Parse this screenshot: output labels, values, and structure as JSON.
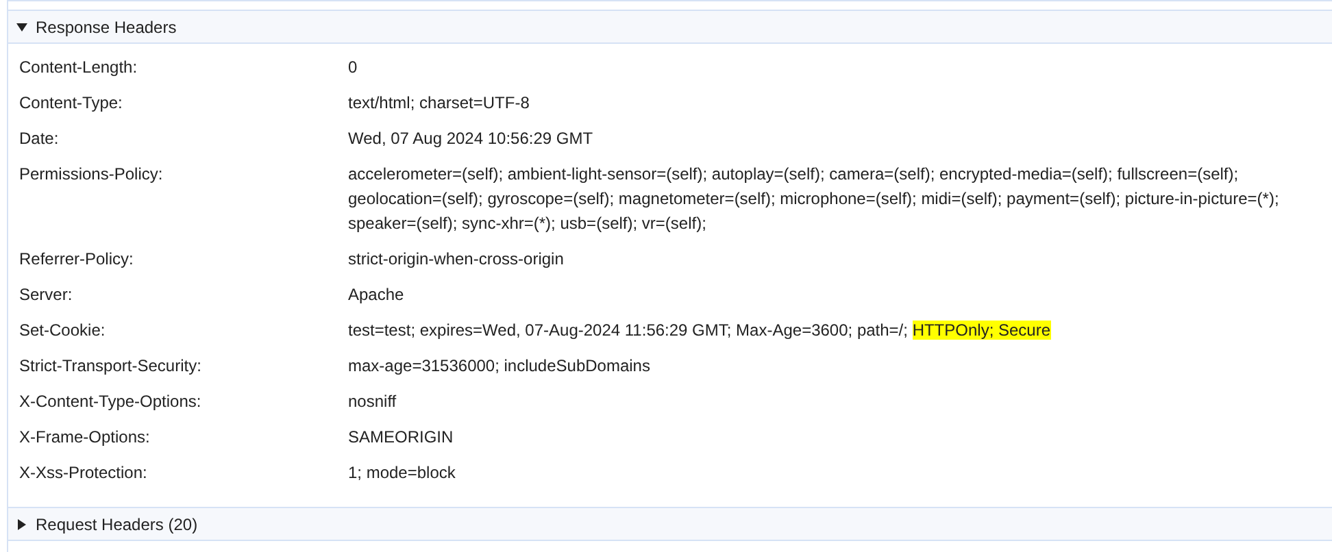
{
  "sections": [
    {
      "title": "Response Headers",
      "expanded": true,
      "headers": [
        {
          "name": "Content-Length:",
          "value": [
            {
              "text": "0",
              "highlighted": false
            }
          ]
        },
        {
          "name": "Content-Type:",
          "value": [
            {
              "text": "text/html; charset=UTF-8",
              "highlighted": false
            }
          ]
        },
        {
          "name": "Date:",
          "value": [
            {
              "text": "Wed, 07 Aug 2024 10:56:29 GMT",
              "highlighted": false
            }
          ]
        },
        {
          "name": "Permissions-Policy:",
          "value": [
            {
              "text": "accelerometer=(self); ambient-light-sensor=(self); autoplay=(self); camera=(self); encrypted-media=(self); fullscreen=(self); geolocation=(self); gyroscope=(self); magnetometer=(self); microphone=(self); midi=(self); payment=(self); picture-in-picture=(*); speaker=(self); sync-xhr=(*); usb=(self); vr=(self);",
              "highlighted": false
            }
          ]
        },
        {
          "name": "Referrer-Policy:",
          "value": [
            {
              "text": "strict-origin-when-cross-origin",
              "highlighted": false
            }
          ]
        },
        {
          "name": "Server:",
          "value": [
            {
              "text": "Apache",
              "highlighted": false
            }
          ]
        },
        {
          "name": "Set-Cookie:",
          "value": [
            {
              "text": "test=test; expires=Wed, 07-Aug-2024 11:56:29 GMT; Max-Age=3600; path=/; ",
              "highlighted": false
            },
            {
              "text": "HTTPOnly; Secure",
              "highlighted": true
            }
          ]
        },
        {
          "name": "Strict-Transport-Security:",
          "value": [
            {
              "text": "max-age=31536000; includeSubDomains",
              "highlighted": false
            }
          ]
        },
        {
          "name": "X-Content-Type-Options:",
          "value": [
            {
              "text": "nosniff",
              "highlighted": false
            }
          ]
        },
        {
          "name": "X-Frame-Options:",
          "value": [
            {
              "text": "SAMEORIGIN",
              "highlighted": false
            }
          ]
        },
        {
          "name": "X-Xss-Protection:",
          "value": [
            {
              "text": "1; mode=block",
              "highlighted": false
            }
          ]
        }
      ]
    },
    {
      "title": "Request Headers (20)",
      "expanded": false
    }
  ]
}
